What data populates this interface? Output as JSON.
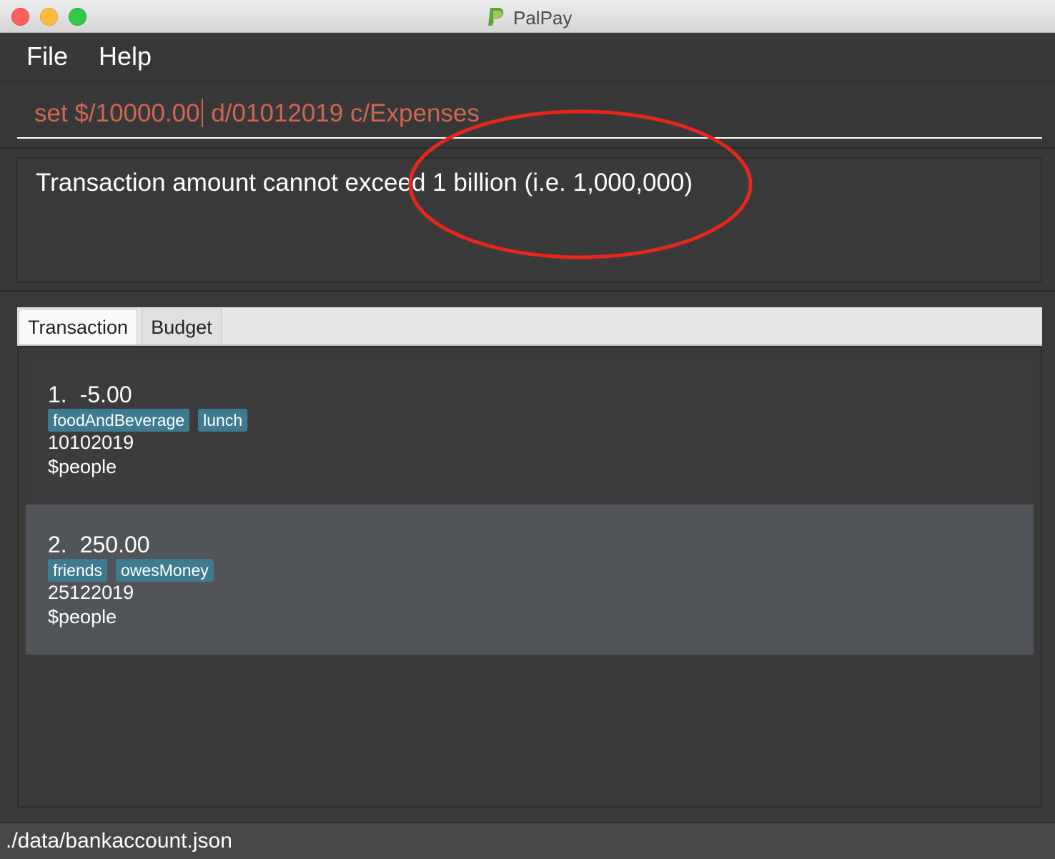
{
  "window": {
    "title": "PalPay"
  },
  "menu": {
    "file": "File",
    "help": "Help"
  },
  "command": {
    "before_caret": "set $/10000.00",
    "after_caret": " d/01012019 c/Expenses"
  },
  "result": {
    "message": "Transaction amount cannot exceed 1 billion (i.e. 1,000,000)"
  },
  "tabs": [
    {
      "label": "Transaction",
      "selected": true
    },
    {
      "label": "Budget",
      "selected": false
    }
  ],
  "transactions": [
    {
      "index": "1.",
      "amount": "-5.00",
      "tags": [
        "foodAndBeverage",
        "lunch"
      ],
      "date": "10102019",
      "people": "$people"
    },
    {
      "index": "2.",
      "amount": "250.00",
      "tags": [
        "friends",
        "owesMoney"
      ],
      "date": "25122019",
      "people": "$people"
    }
  ],
  "status": {
    "path": "./data/bankaccount.json"
  },
  "colors": {
    "command_text": "#d06651",
    "tag_background": "#3e7b91",
    "annotation_circle": "#e8261e",
    "logo": "#7cb342"
  }
}
